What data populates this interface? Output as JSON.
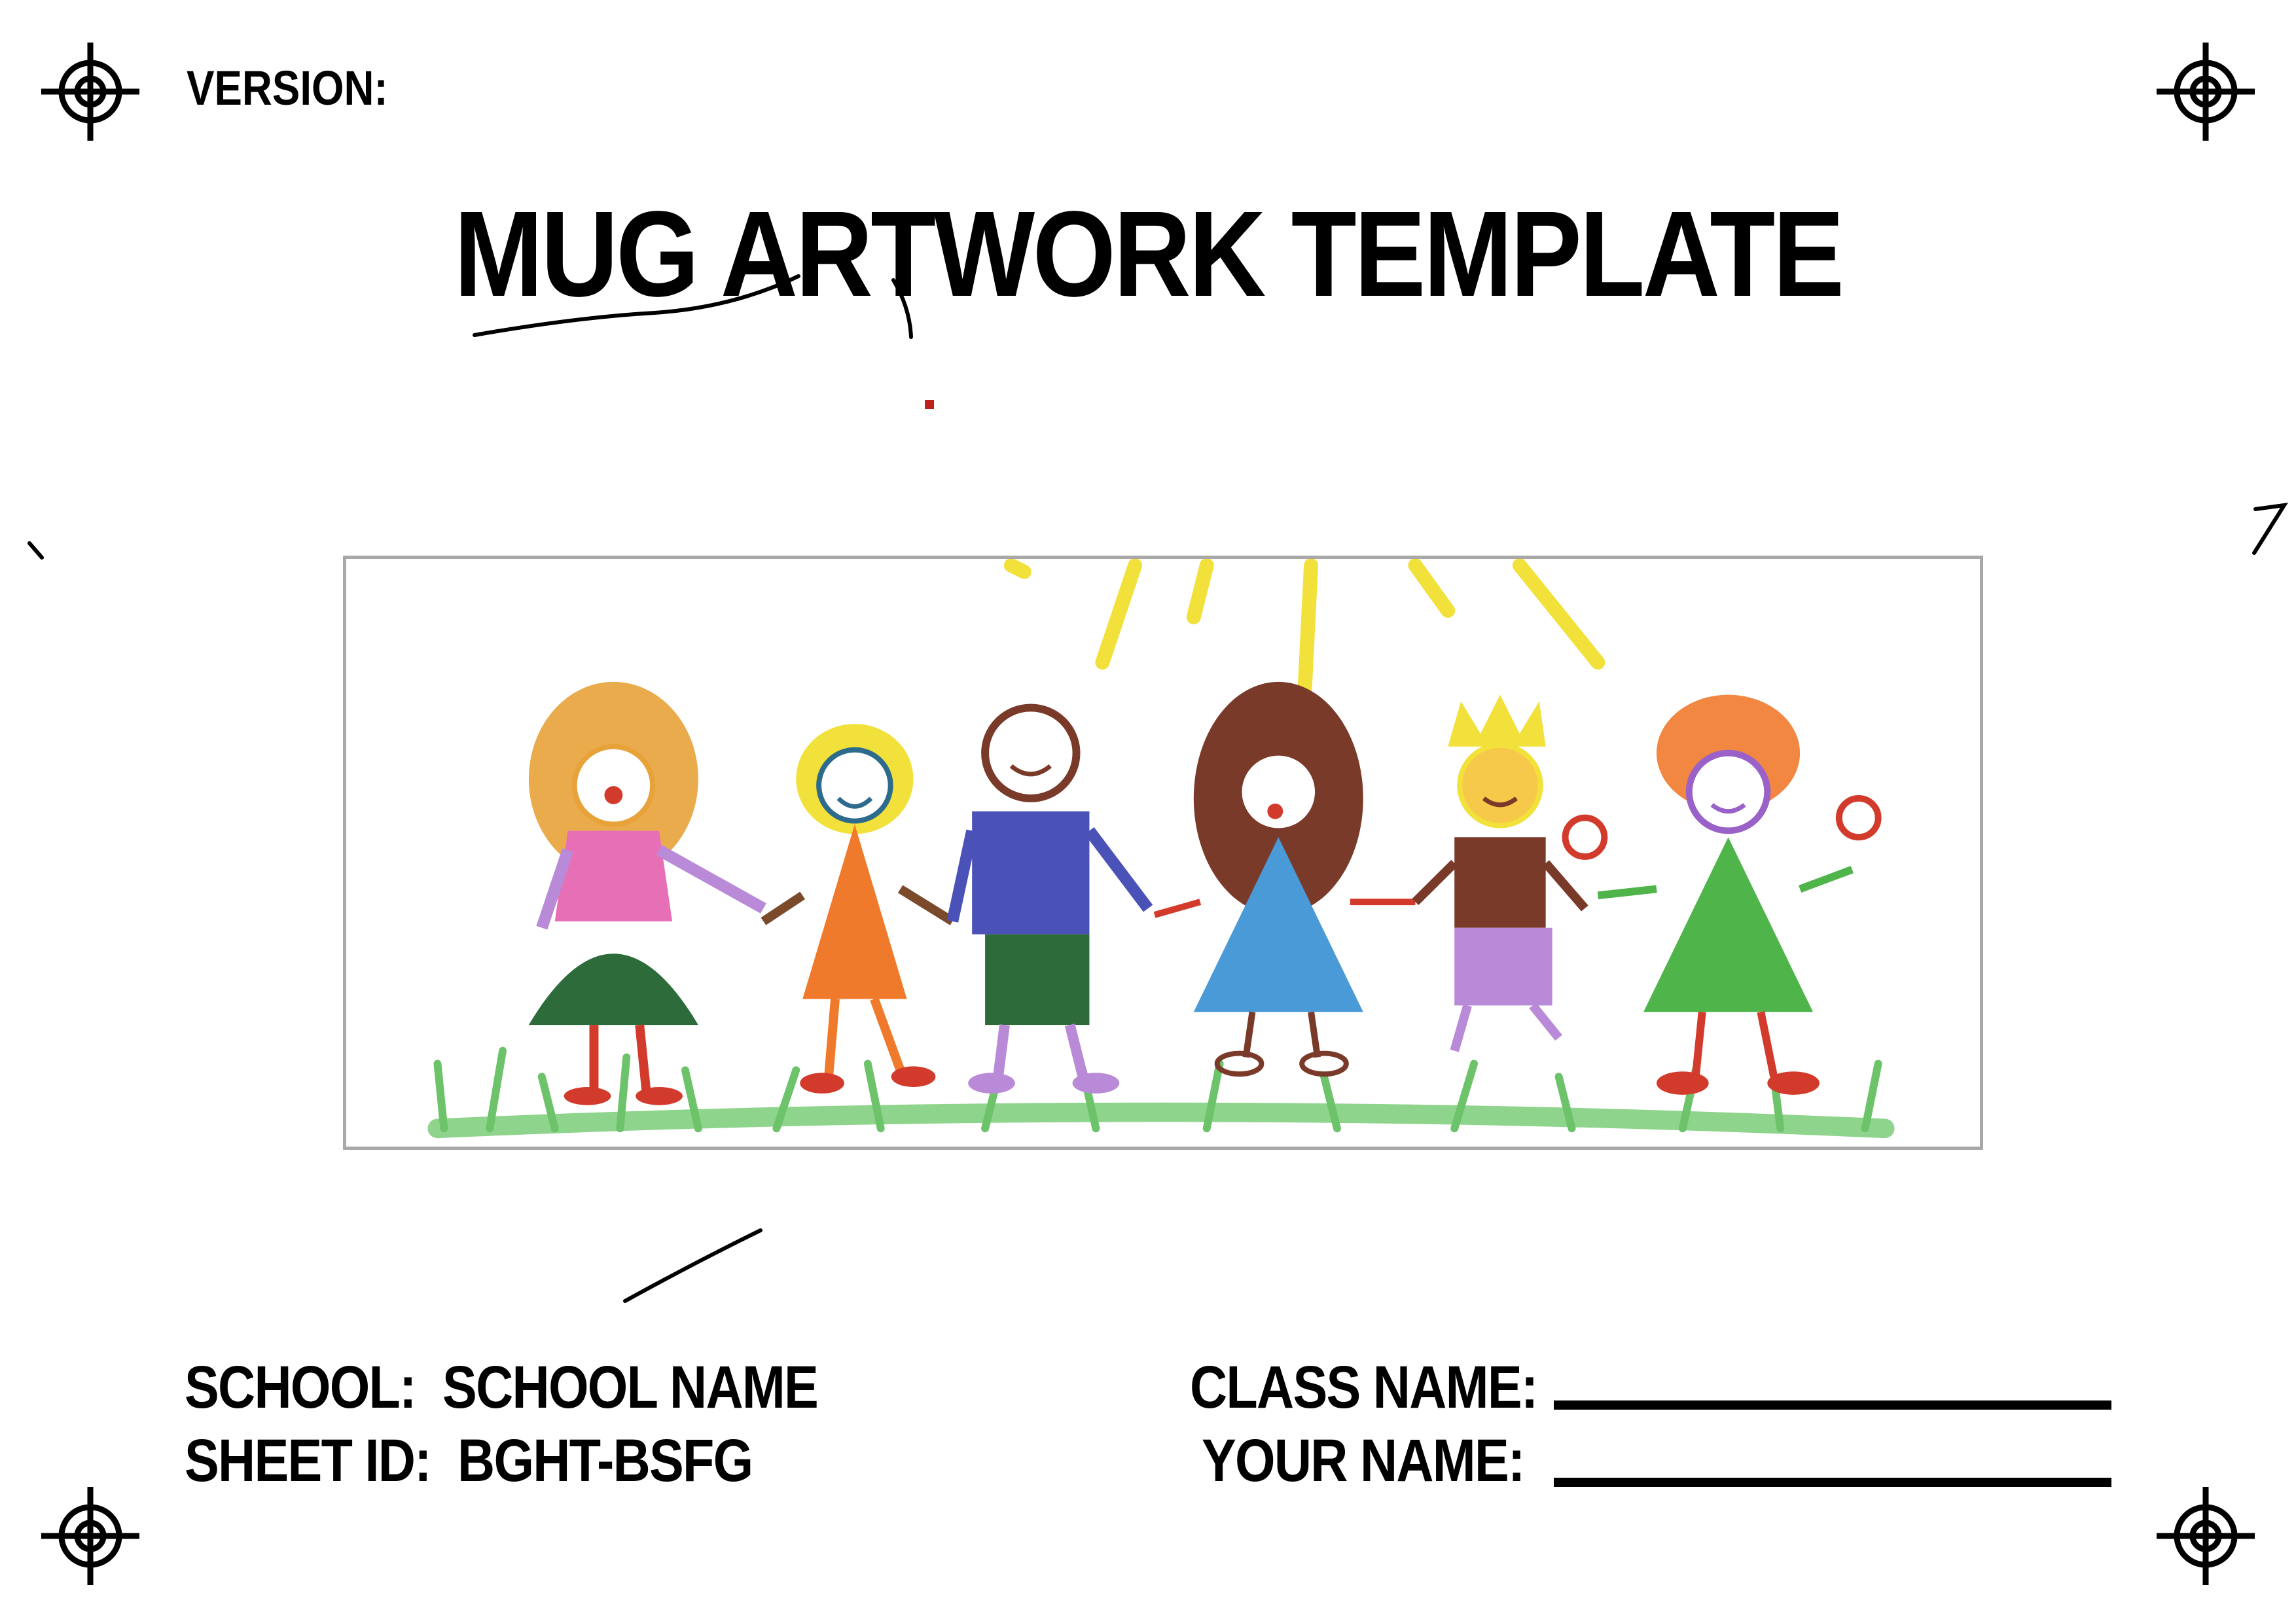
{
  "header": {
    "version_label": "VERSION:",
    "title": "MUG ARTWORK TEMPLATE"
  },
  "artwork": {
    "icon": "childrens-drawing-image",
    "description_colors": {
      "sun": "#f2e13a",
      "grass": "#6cc36a",
      "frame_border": "#a8a8a8"
    }
  },
  "footer": {
    "school_label": "SCHOOL:",
    "school_value": "SCHOOL NAME",
    "sheet_label": "SHEET ID:",
    "sheet_value": "BGHT-BSFG",
    "class_label": "CLASS NAME:",
    "your_name_label": "YOUR NAME:"
  },
  "marks": {
    "icon": "registration-crosshair-icon"
  }
}
